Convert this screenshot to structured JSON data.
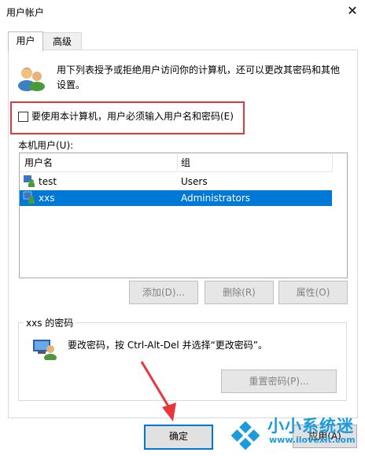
{
  "window": {
    "title": "用户帐户",
    "close_glyph": "✕"
  },
  "tabs": [
    {
      "label": "用户"
    },
    {
      "label": "高级"
    }
  ],
  "description": "用下列表授予或拒绝用户访问你的计算机，还可以更改其密码和其他设置。",
  "require_login_checkbox": {
    "label": "要使用本计算机，用户必须输入用户名和密码(E)",
    "checked": false
  },
  "users_list": {
    "label": "本机用户(U):",
    "columns": [
      "用户名",
      "组"
    ],
    "rows": [
      {
        "name": "test",
        "group": "Users",
        "selected": false
      },
      {
        "name": "xxs",
        "group": "Administrators",
        "selected": true
      }
    ]
  },
  "list_buttons": {
    "add": "添加(D)...",
    "remove": "删除(R)",
    "properties": "属性(O)"
  },
  "password_group": {
    "title": "xxs 的密码",
    "text": "要改密码，按 Ctrl-Alt-Del 并选择“更改密码”。",
    "reset_button": "重置密码(P)..."
  },
  "dialog_buttons": {
    "ok": "确定",
    "apply": "应用(A)"
  },
  "annotation": {
    "highlight_color": "#e8363a"
  },
  "watermark": {
    "name": "小小系统迷",
    "url": "www.ilovexit.com",
    "color": "#1a9bdc"
  },
  "colors": {
    "selection": "#0078d7",
    "accent": "#0078d7"
  }
}
